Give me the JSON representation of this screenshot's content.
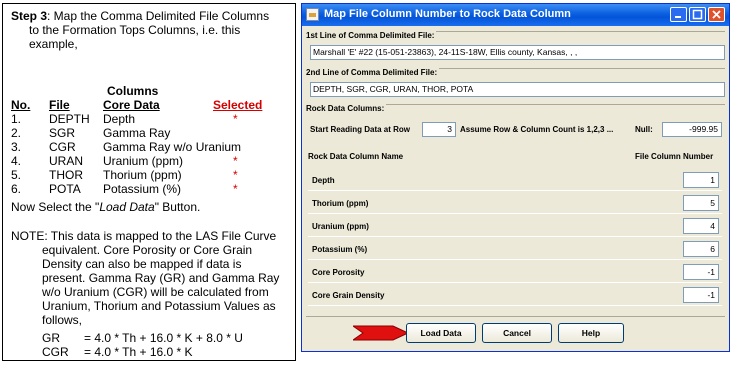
{
  "instructions": {
    "step_label": "Step 3",
    "step_text": ": Map the Comma Delimited File  Columns",
    "step_text_2": "to the Formation Tops Columns, i.e. this",
    "step_text_3": "example,",
    "columns_header": "Columns",
    "headers": {
      "no": "No.",
      "file": "File",
      "core": "Core Data",
      "selected": "Selected"
    },
    "rows": [
      {
        "no": "1.",
        "file": "DEPTH",
        "core": "Depth",
        "selected": "*"
      },
      {
        "no": "2.",
        "file": "SGR",
        "core": "Gamma Ray",
        "selected": ""
      },
      {
        "no": "3.",
        "file": "CGR",
        "core": "Gamma Ray w/o Uranium",
        "selected": ""
      },
      {
        "no": "4.",
        "file": "URAN",
        "core": "Uranium (ppm)",
        "selected": "*"
      },
      {
        "no": "5.",
        "file": "THOR",
        "core": "Thorium (ppm)",
        "selected": "*"
      },
      {
        "no": "6.",
        "file": "POTA",
        "core": "Potassium (%)",
        "selected": "*"
      }
    ],
    "now_select_pre": "Now Select the \"",
    "now_select_em": "Load Data",
    "now_select_post": "\" Button.",
    "note_lines": [
      "NOTE: This data is mapped to the LAS File Curve",
      "equivalent.  Core Porosity or Core Grain",
      "Density can also be mapped if data is",
      "present. Gamma Ray (GR) and Gamma Ray",
      "w/o Uranium (CGR) will be calculated from",
      "Uranium, Thorium and Potassium Values as",
      "follows,"
    ],
    "formulas": [
      {
        "name": "GR",
        "expr": "= 4.0 * Th + 16.0 * K + 8.0 * U"
      },
      {
        "name": "CGR",
        "expr": "= 4.0 * Th + 16.0 * K"
      }
    ]
  },
  "dialog": {
    "title": "Map File Column Number to Rock Data Column",
    "line1_label": "1st Line of Comma Delimited File:",
    "line1_value": "Marshall 'E' #22 (15-051-23863),  24-11S-18W,  Ellis county,  Kansas, , ,",
    "line2_label": "2nd Line of Comma Delimited File:",
    "line2_value": "DEPTH, SGR, CGR, URAN, THOR, POTA",
    "rock_label": "Rock Data Columns:",
    "start_row_label": "Start Reading Data at Row",
    "start_row_value": "3",
    "count_label": "Assume Row & Column Count is 1,2,3 ...",
    "null_label": "Null:",
    "null_value": "-999.95",
    "col_name_header": "Rock Data Column Name",
    "col_num_header": "File Column Number",
    "mappings": [
      {
        "name": "Depth",
        "value": "1"
      },
      {
        "name": "Thorium (ppm)",
        "value": "5"
      },
      {
        "name": "Uranium (ppm)",
        "value": "4"
      },
      {
        "name": "Potassium (%)",
        "value": "6"
      },
      {
        "name": "Core Porosity",
        "value": "-1"
      },
      {
        "name": "Core Grain Density",
        "value": "-1"
      }
    ],
    "buttons": {
      "load": "Load Data",
      "cancel": "Cancel",
      "help": "Help"
    },
    "colors": {
      "title_bar": "#0a5fe0",
      "window_bg": "#ece9d8",
      "arrow": "#e01010",
      "selected_star": "#d40000"
    }
  }
}
